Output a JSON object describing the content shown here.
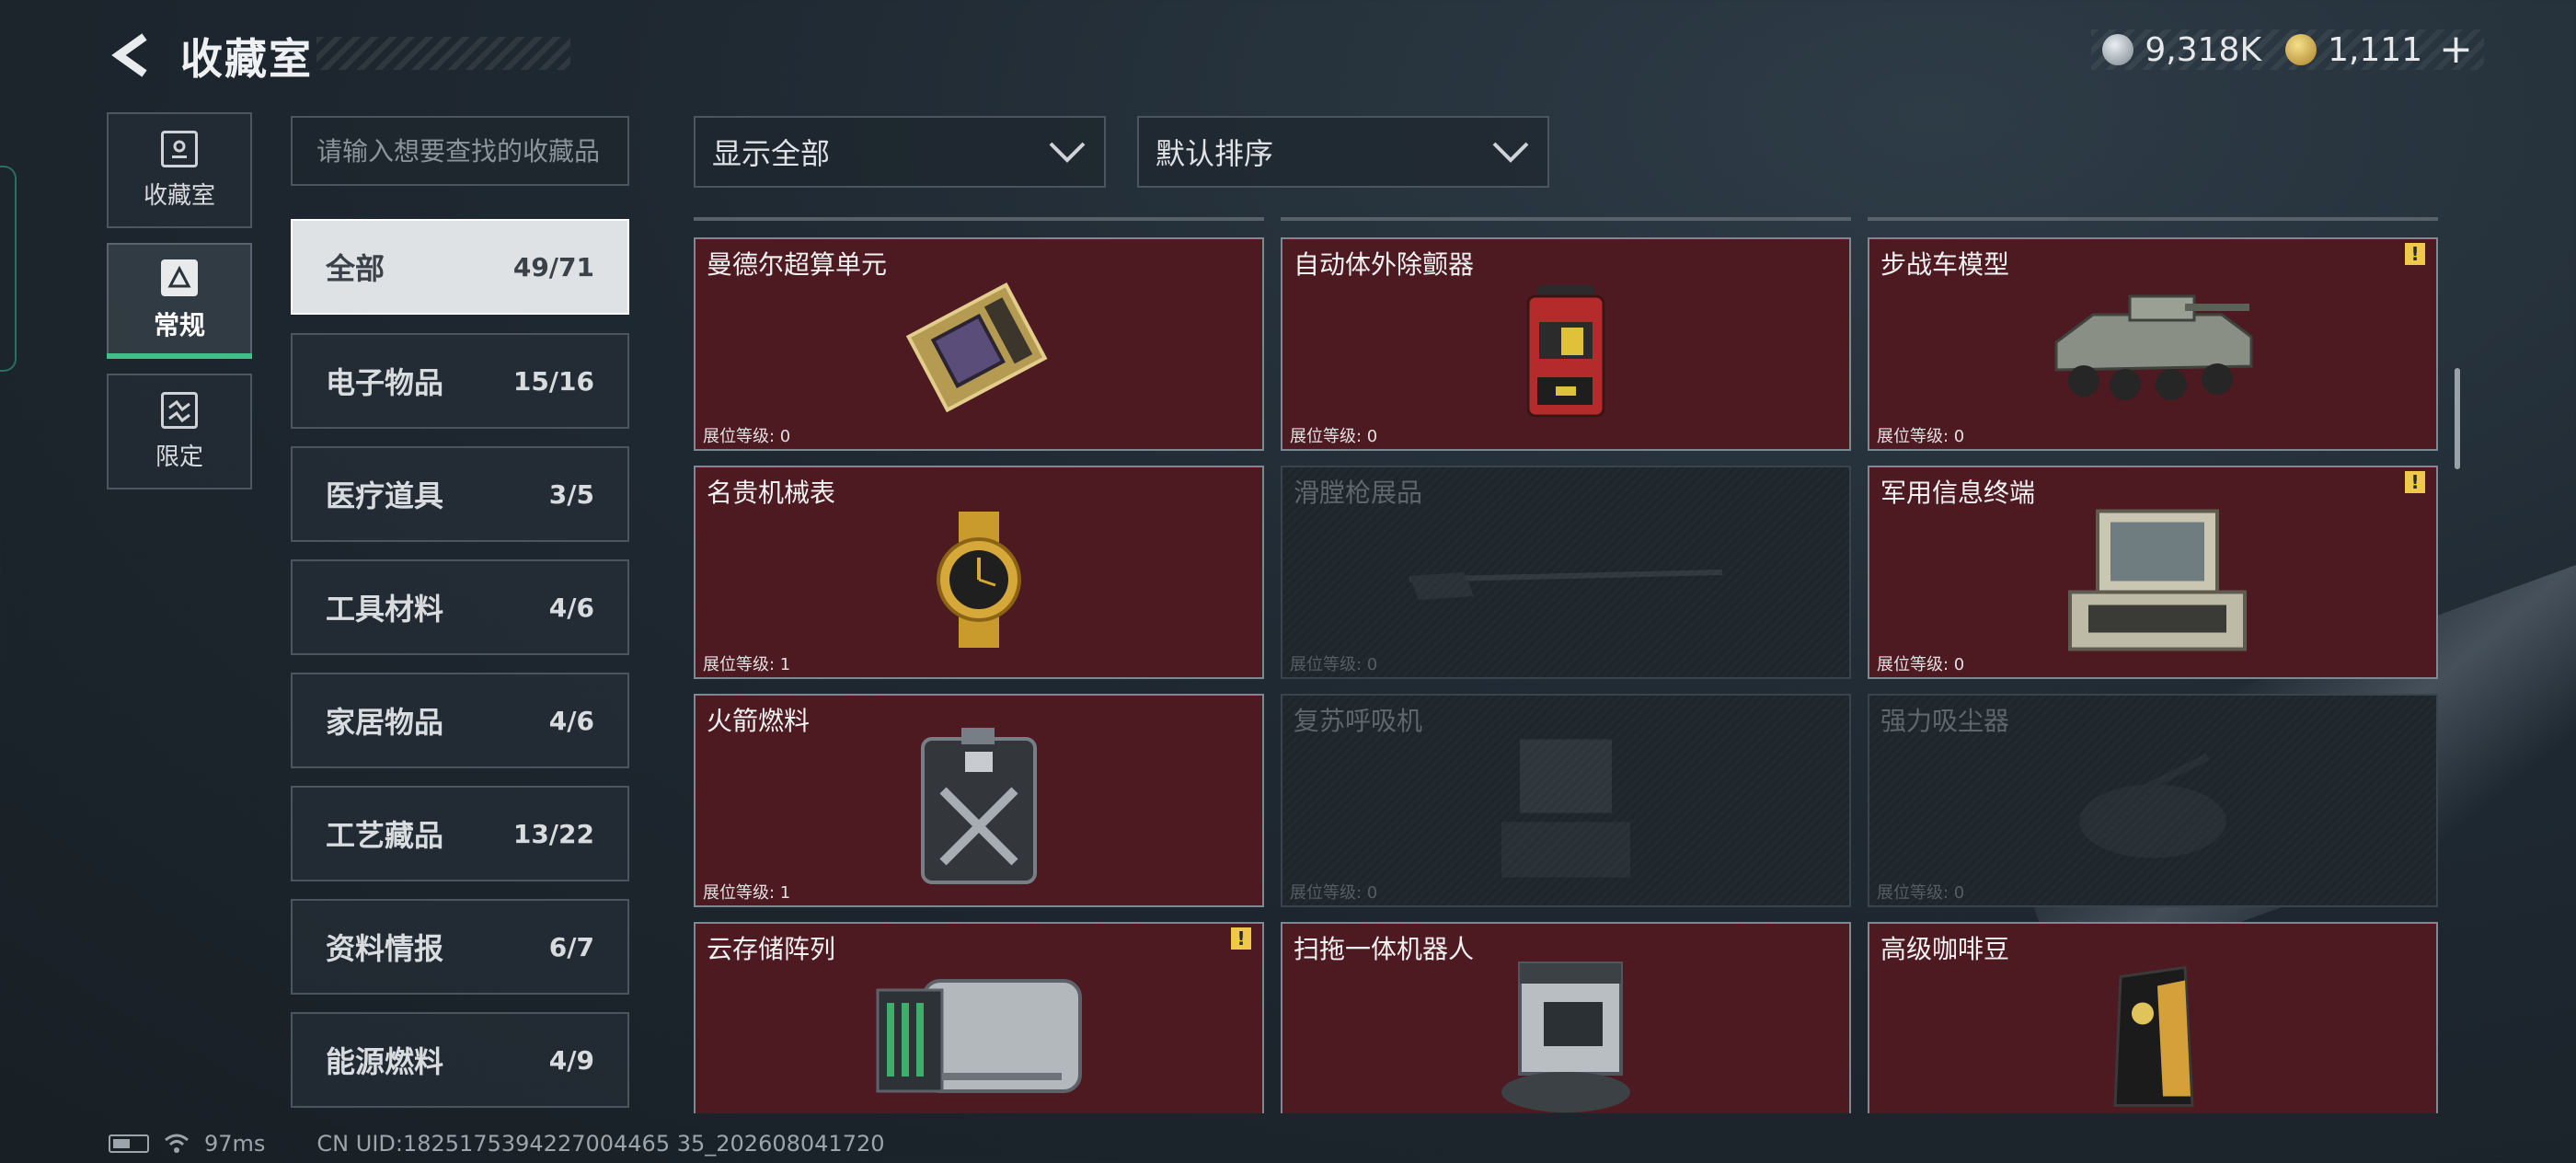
{
  "header": {
    "title": "收藏室"
  },
  "currency": {
    "silver": "9,318K",
    "gold": "1,111"
  },
  "side_tabs": [
    {
      "label": "收藏室",
      "icon": "collection-room-icon"
    },
    {
      "label": "常规",
      "icon": "regular-icon",
      "active": true
    },
    {
      "label": "限定",
      "icon": "limited-icon"
    }
  ],
  "search": {
    "placeholder": "请输入想要查找的收藏品"
  },
  "categories": [
    {
      "name": "全部",
      "count": "49/71",
      "active": true
    },
    {
      "name": "电子物品",
      "count": "15/16"
    },
    {
      "name": "医疗道具",
      "count": "3/5"
    },
    {
      "name": "工具材料",
      "count": "4/6"
    },
    {
      "name": "家居物品",
      "count": "4/6"
    },
    {
      "name": "工艺藏品",
      "count": "13/22"
    },
    {
      "name": "资料情报",
      "count": "6/7"
    },
    {
      "name": "能源燃料",
      "count": "4/9"
    }
  ],
  "filters": {
    "display": "显示全部",
    "sort": "默认排序"
  },
  "items": [
    {
      "name": "曼德尔超算单元",
      "level": "展位等级: 0",
      "owned": true,
      "warning": false,
      "icon": "supercomputer-unit-icon"
    },
    {
      "name": "自动体外除颤器",
      "level": "展位等级: 0",
      "owned": true,
      "warning": false,
      "icon": "defibrillator-icon"
    },
    {
      "name": "步战车模型",
      "level": "展位等级: 0",
      "owned": true,
      "warning": true,
      "icon": "ifv-model-icon"
    },
    {
      "name": "名贵机械表",
      "level": "展位等级: 1",
      "owned": true,
      "warning": false,
      "icon": "mechanical-watch-icon"
    },
    {
      "name": "滑膛枪展品",
      "level": "展位等级: 0",
      "owned": false,
      "warning": false,
      "icon": "musket-icon"
    },
    {
      "name": "军用信息终端",
      "level": "展位等级: 0",
      "owned": true,
      "warning": true,
      "icon": "military-terminal-icon"
    },
    {
      "name": "火箭燃料",
      "level": "展位等级: 1",
      "owned": true,
      "warning": false,
      "icon": "rocket-fuel-icon"
    },
    {
      "name": "复苏呼吸机",
      "level": "展位等级: 0",
      "owned": false,
      "warning": false,
      "icon": "ventilator-icon"
    },
    {
      "name": "强力吸尘器",
      "level": "展位等级: 0",
      "owned": false,
      "warning": false,
      "icon": "vacuum-icon"
    },
    {
      "name": "云存储阵列",
      "level": "",
      "owned": true,
      "warning": true,
      "icon": "cloud-storage-icon"
    },
    {
      "name": "扫拖一体机器人",
      "level": "",
      "owned": true,
      "warning": false,
      "icon": "robot-mop-icon"
    },
    {
      "name": "高级咖啡豆",
      "level": "",
      "owned": true,
      "warning": false,
      "icon": "coffee-beans-icon"
    }
  ],
  "status": {
    "ping": "97ms",
    "uid": "CN UID:1825175394227004465 35_202608041720"
  },
  "colors": {
    "owned_card": "#4e1a22",
    "active_accent": "#3fbf8a",
    "warning": "#f0c94a"
  }
}
